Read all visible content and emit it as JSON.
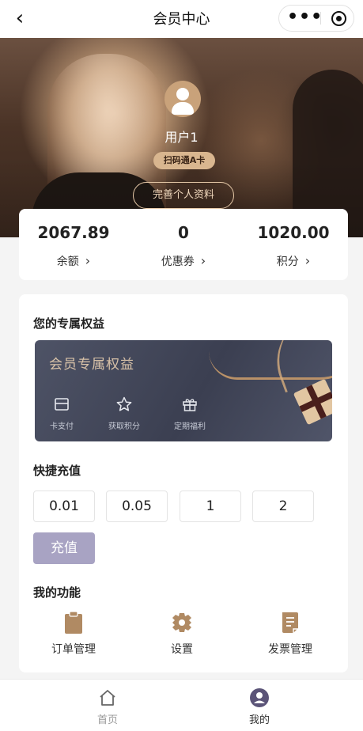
{
  "navbar": {
    "title": "会员中心",
    "back_icon": "chevron-left-icon",
    "more_icon": "more-dots-icon",
    "close_icon": "target-icon"
  },
  "profile": {
    "username": "用户1",
    "card_badge": "扫码通A卡",
    "complete_profile_label": "完善个人资料"
  },
  "stats": [
    {
      "value": "2067.89",
      "label": "余额"
    },
    {
      "value": "0",
      "label": "优惠券"
    },
    {
      "value": "1020.00",
      "label": "积分"
    }
  ],
  "benefits": {
    "section_title": "您的专属权益",
    "card_title": "会员专属权益",
    "items": [
      {
        "label": "卡支付",
        "icon": "card-pay-icon"
      },
      {
        "label": "获取积分",
        "icon": "star-icon"
      },
      {
        "label": "定期福利",
        "icon": "gift-icon"
      }
    ]
  },
  "recharge": {
    "section_title": "快捷充值",
    "amounts": [
      "0.01",
      "0.05",
      "1",
      "2"
    ],
    "button_label": "充值",
    "button_color": "#a8a3c3"
  },
  "functions": {
    "section_title": "我的功能",
    "items": [
      {
        "label": "订单管理",
        "icon": "clipboard-icon"
      },
      {
        "label": "设置",
        "icon": "gear-icon"
      },
      {
        "label": "发票管理",
        "icon": "invoice-icon"
      }
    ],
    "icon_color": "#b08a63"
  },
  "tabbar": [
    {
      "label": "首页",
      "icon": "home-icon",
      "active": false
    },
    {
      "label": "我的",
      "icon": "user-icon",
      "active": true
    }
  ],
  "colors": {
    "accent": "#5b5478",
    "gold": "#d9b68f"
  }
}
